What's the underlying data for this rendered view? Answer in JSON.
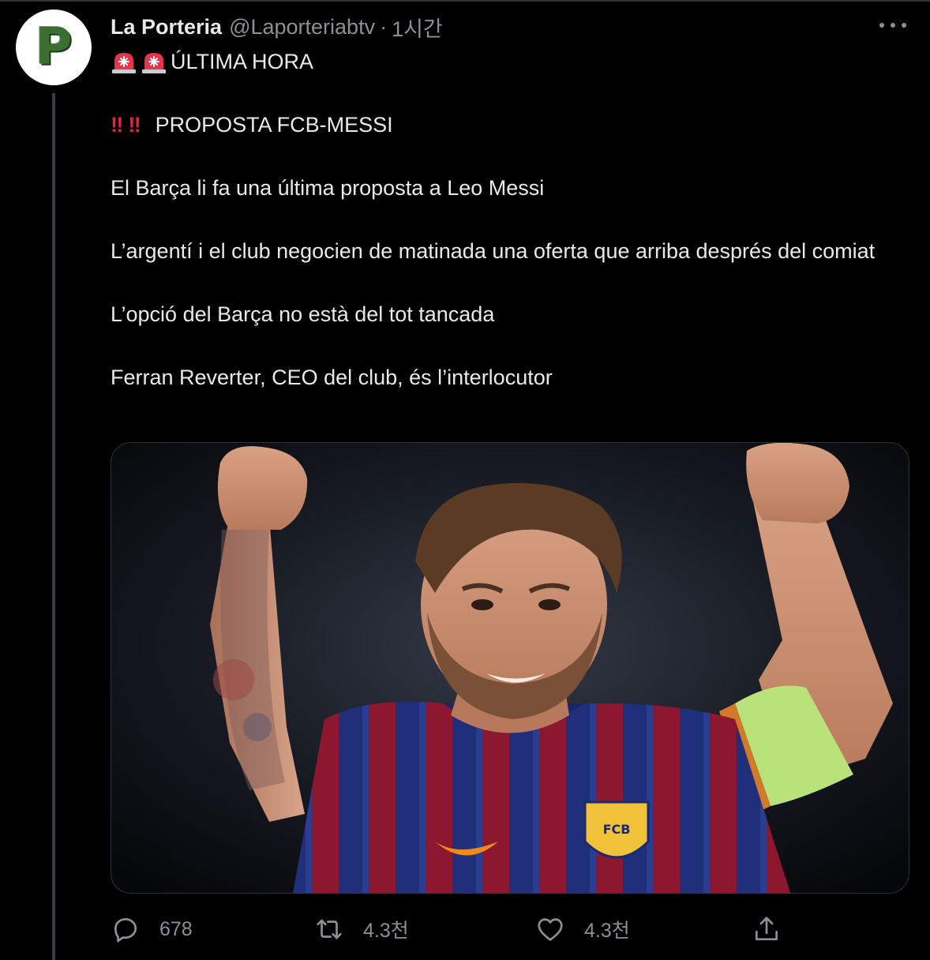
{
  "tweet": {
    "display_name": "La Porteria",
    "handle": "@Laporteriabtv",
    "separator": "·",
    "time": "1시간",
    "avatar_letter": "P",
    "lines": {
      "headline": "ÚLTIMA HORA",
      "bang_prefix": "‼",
      "subheadline": "PROPOSTA FCB-MESSI",
      "p1": "El Barça li fa una última proposta a Leo Messi",
      "p2": "L’argentí i el club negocien de matinada una oferta que arriba després del comiat",
      "p3": "L’opció del Barça no està del tot tancada",
      "p4": "Ferran Reverter, CEO del club, és l’interlocutor"
    },
    "media": {
      "shirt_badge": "FCB"
    }
  },
  "actions": {
    "reply_count": "678",
    "retweet_count": "4.3천",
    "like_count": "4.3천"
  },
  "icons": {
    "siren": "police-siren-icon",
    "more": "more-dots-icon",
    "reply": "reply-icon",
    "retweet": "retweet-icon",
    "like": "heart-icon",
    "share": "share-icon"
  },
  "colors": {
    "background": "#000000",
    "text": "#e7e9ea",
    "secondary": "#8b9095",
    "bangs": "#e3243b",
    "avatar_green": "#3c6e32"
  }
}
